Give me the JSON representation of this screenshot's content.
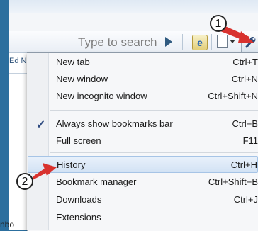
{
  "window": {
    "left_tab_fragment": "Ed N",
    "left_bottom_fragment": "nbo"
  },
  "toolbar": {
    "search_placeholder": "Type to search",
    "search_go_icon": "search-go-arrow-icon",
    "ie_icon_label": "e",
    "page_icon": "page-icon",
    "wrench_icon": "wrench-icon"
  },
  "menu": {
    "items": [
      {
        "label": "New tab",
        "shortcut": "Ctrl+T"
      },
      {
        "label": "New window",
        "shortcut": "Ctrl+N"
      },
      {
        "label": "New incognito window",
        "shortcut": "Ctrl+Shift+N"
      },
      {
        "label": "Always show bookmarks bar",
        "shortcut": "Ctrl+B",
        "checked": true
      },
      {
        "label": "Full screen",
        "shortcut": "F11"
      },
      {
        "label": "History",
        "shortcut": "Ctrl+H",
        "highlighted": true
      },
      {
        "label": "Bookmark manager",
        "shortcut": "Ctrl+Shift+B"
      },
      {
        "label": "Downloads",
        "shortcut": "Ctrl+J"
      },
      {
        "label": "Extensions",
        "shortcut": ""
      }
    ],
    "check_mark": "✓"
  },
  "callouts": {
    "one": "1",
    "two": "2"
  },
  "colors": {
    "callout_arrow": "#d8322e",
    "highlight": "#d2e2f4"
  }
}
